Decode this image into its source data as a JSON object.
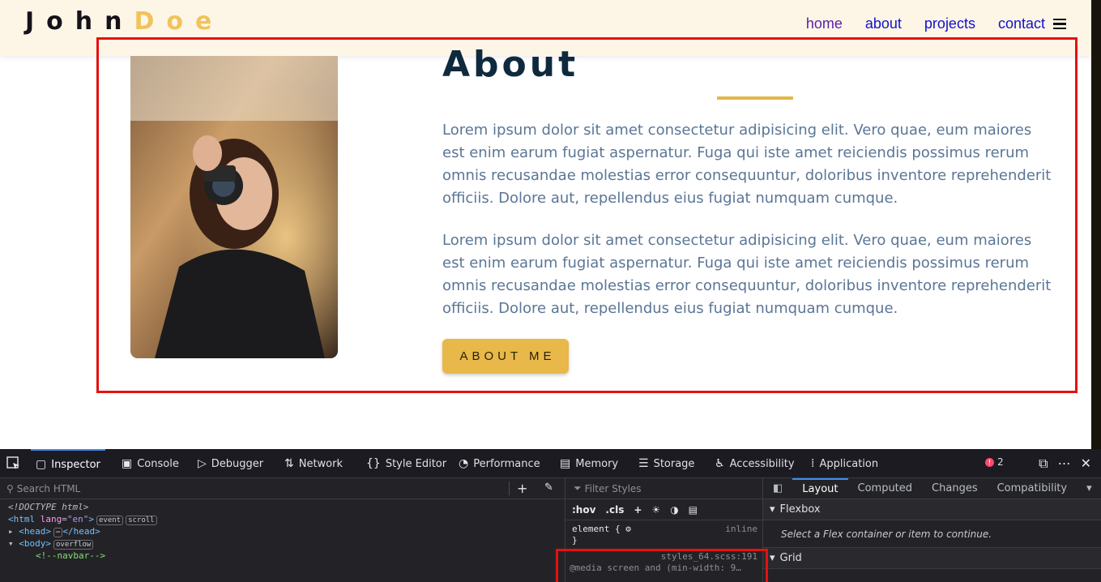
{
  "site": {
    "logo": {
      "part1": "John",
      "part2": "Doe"
    },
    "nav": [
      "home",
      "about",
      "projects",
      "contact"
    ],
    "about": {
      "title": "About",
      "paragraphs": [
        "Lorem ipsum dolor sit amet consectetur adipisicing elit. Vero quae, eum maiores est enim earum fugiat aspernatur. Fuga qui iste amet reiciendis possimus rerum omnis recusandae molestias error consequuntur, doloribus inventore reprehenderit officiis. Dolore aut, repellendus eius fugiat numquam cumque.",
        "Lorem ipsum dolor sit amet consectetur adipisicing elit. Vero quae, eum maiores est enim earum fugiat aspernatur. Fuga qui iste amet reiciendis possimus rerum omnis recusandae molestias error consequuntur, doloribus inventore reprehenderit officiis. Dolore aut, repellendus eius fugiat numquam cumque."
      ],
      "button": "ABOUT ME"
    },
    "colors": {
      "accent": "#e8b84a",
      "title": "#0f2a3d",
      "text": "#5a7696",
      "highlight": "#e51111"
    }
  },
  "devtools": {
    "tabs": [
      "Inspector",
      "Console",
      "Debugger",
      "Network",
      "Style Editor",
      "Performance",
      "Memory",
      "Storage",
      "Accessibility",
      "Application"
    ],
    "error_count": "2",
    "search_placeholder": "Search HTML",
    "filter_placeholder": "Filter Styles",
    "rules_toolbar": [
      ":hov",
      ".cls"
    ],
    "html_lines": {
      "doctype": "<!DOCTYPE html>",
      "html_tag": "html",
      "html_attr": "lang",
      "html_val": "\"en\"",
      "html_pill1": "event",
      "html_pill2": "scroll",
      "head": "<head>",
      "head_close": "</head>",
      "body_tag": "body",
      "body_pill": "overflow",
      "comment": "<!--navbar-->"
    },
    "rules": {
      "element_selector": "element {",
      "element_close": "}",
      "inline_label": "inline",
      "source": "styles_64.scss:191",
      "media": "@media screen and (min-width: 9…"
    },
    "layout_tabs": [
      "Layout",
      "Computed",
      "Changes",
      "Compatibility"
    ],
    "flexbox": {
      "header": "Flexbox",
      "message": "Select a Flex container or item to continue."
    },
    "grid": {
      "header": "Grid"
    }
  }
}
